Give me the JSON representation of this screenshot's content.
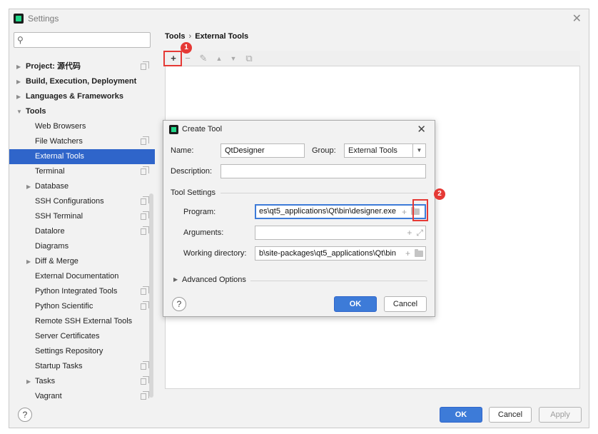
{
  "window": {
    "title": "Settings"
  },
  "search": {
    "placeholder": "",
    "value": ""
  },
  "sidebar": {
    "items": [
      {
        "label": "Project: 源代码",
        "level": 0,
        "arrow": "▶",
        "bold": true,
        "icon": "copy-icon"
      },
      {
        "label": "Build, Execution, Deployment",
        "level": 0,
        "arrow": "▶",
        "bold": true
      },
      {
        "label": "Languages & Frameworks",
        "level": 0,
        "arrow": "▶",
        "bold": true
      },
      {
        "label": "Tools",
        "level": 0,
        "arrow": "▼",
        "bold": true
      },
      {
        "label": "Web Browsers",
        "level": 1
      },
      {
        "label": "File Watchers",
        "level": 1,
        "icon": "copy-icon"
      },
      {
        "label": "External Tools",
        "level": 1,
        "selected": true
      },
      {
        "label": "Terminal",
        "level": 1,
        "icon": "copy-icon"
      },
      {
        "label": "Database",
        "level": 1,
        "arrow": "▶"
      },
      {
        "label": "SSH Configurations",
        "level": 1,
        "icon": "copy-icon"
      },
      {
        "label": "SSH Terminal",
        "level": 1,
        "icon": "copy-icon"
      },
      {
        "label": "Datalore",
        "level": 1,
        "icon": "copy-icon"
      },
      {
        "label": "Diagrams",
        "level": 1
      },
      {
        "label": "Diff & Merge",
        "level": 1,
        "arrow": "▶"
      },
      {
        "label": "External Documentation",
        "level": 1
      },
      {
        "label": "Python Integrated Tools",
        "level": 1,
        "icon": "copy-icon"
      },
      {
        "label": "Python Scientific",
        "level": 1,
        "icon": "copy-icon"
      },
      {
        "label": "Remote SSH External Tools",
        "level": 1
      },
      {
        "label": "Server Certificates",
        "level": 1
      },
      {
        "label": "Settings Repository",
        "level": 1
      },
      {
        "label": "Startup Tasks",
        "level": 1,
        "icon": "copy-icon"
      },
      {
        "label": "Tasks",
        "level": 1,
        "arrow": "▶",
        "icon": "copy-icon"
      },
      {
        "label": "Vagrant",
        "level": 1,
        "icon": "copy-icon"
      }
    ]
  },
  "breadcrumb": {
    "parent": "Tools",
    "separator": "›",
    "current": "External Tools"
  },
  "toolbar": {
    "add": "+",
    "remove": "−",
    "edit": "✎",
    "up": "▲",
    "down": "▼",
    "copy": "⧉"
  },
  "markers": {
    "one": "1",
    "two": "2"
  },
  "dialog": {
    "title": "Create Tool",
    "name_label": "Name:",
    "name_value": "QtDesigner",
    "group_label": "Group:",
    "group_value": "External Tools",
    "description_label": "Description:",
    "description_value": "",
    "tool_settings_label": "Tool Settings",
    "program_label": "Program:",
    "program_value": "es\\qt5_applications\\Qt\\bin\\designer.exe",
    "arguments_label": "Arguments:",
    "arguments_value": "",
    "workdir_label": "Working directory:",
    "workdir_value": "b\\site-packages\\qt5_applications\\Qt\\bin",
    "advanced_label": "Advanced Options",
    "help": "?",
    "ok": "OK",
    "cancel": "Cancel"
  },
  "footer": {
    "help": "?",
    "ok": "OK",
    "cancel": "Cancel",
    "apply": "Apply"
  },
  "colors": {
    "accent": "#2f65ca",
    "primary_button": "#3d7bd8",
    "marker": "#e53935"
  }
}
